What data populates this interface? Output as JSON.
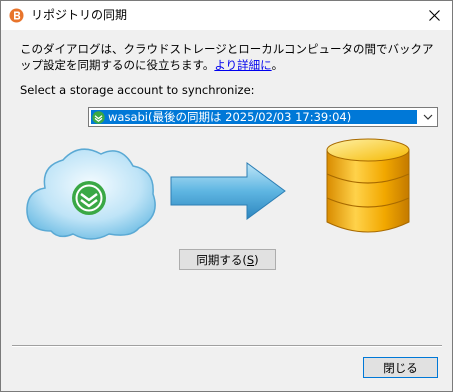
{
  "window": {
    "title": "リポジトリの同期"
  },
  "description": {
    "text": "このダイアログは、クラウドストレージとローカルコンピュータの間でバックアップ設定を同期するのに役立ちます。",
    "link": "より詳細に",
    "suffix": "。"
  },
  "account": {
    "label": "Select a storage account to synchronize:",
    "selected": "wasabi(最後の同期は 2025/02/03  17:39:04)"
  },
  "buttons": {
    "sync": "同期する",
    "sync_accel": "S",
    "close": "閉じる"
  },
  "colors": {
    "selection": "#0078d7",
    "wasabi_green": "#3aa845",
    "app_orange": "#e8742b"
  }
}
